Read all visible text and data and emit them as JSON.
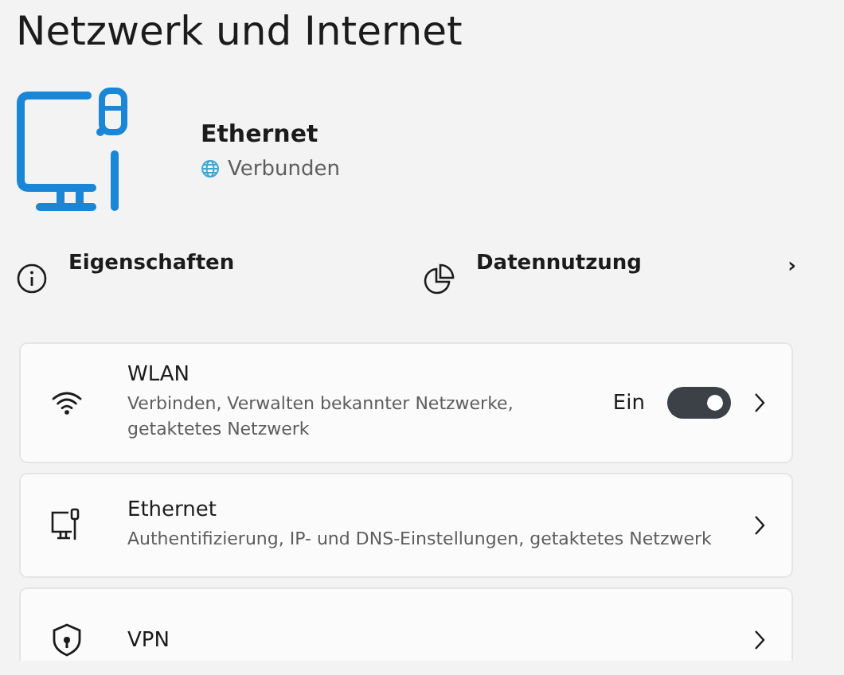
{
  "page": {
    "title": "Netzwerk und Internet"
  },
  "hero": {
    "name": "Ethernet",
    "status": "Verbunden"
  },
  "quick_links": [
    {
      "label": "Eigenschaften"
    },
    {
      "label": "Datennutzung",
      "chevron": "›"
    }
  ],
  "cards": [
    {
      "kind": "toggle",
      "title": "WLAN",
      "subtitle": "Verbinden, Verwalten bekannter Netzwerke, getaktetes Netzwerk",
      "state_label": "Ein",
      "on": true
    },
    {
      "kind": "link",
      "title": "Ethernet",
      "subtitle": "Authentifizierung, IP- und DNS-Einstellungen, getaktetes Netzwerk"
    },
    {
      "kind": "link",
      "title": "VPN"
    }
  ]
}
